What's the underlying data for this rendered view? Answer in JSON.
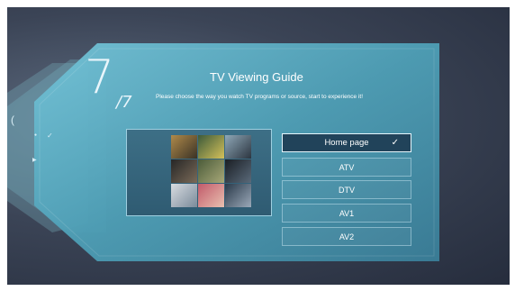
{
  "step": {
    "current": "7",
    "total": "/7"
  },
  "guide": {
    "title": "TV Viewing Guide",
    "description": "Please choose the way you watch TV programs or source, start to experience it!"
  },
  "options": [
    {
      "label": "Home page",
      "selected": true
    },
    {
      "label": "ATV",
      "selected": false
    },
    {
      "label": "DTV",
      "selected": false
    },
    {
      "label": "AV1",
      "selected": false
    },
    {
      "label": "AV2",
      "selected": false
    }
  ],
  "selected_mark": "✓",
  "side_panel": {
    "label": "",
    "check_icon": "✓"
  },
  "colors": {
    "panel_main": "#5aaec4",
    "panel_dark": "#21435a",
    "screen_bg": "#3b4456"
  }
}
